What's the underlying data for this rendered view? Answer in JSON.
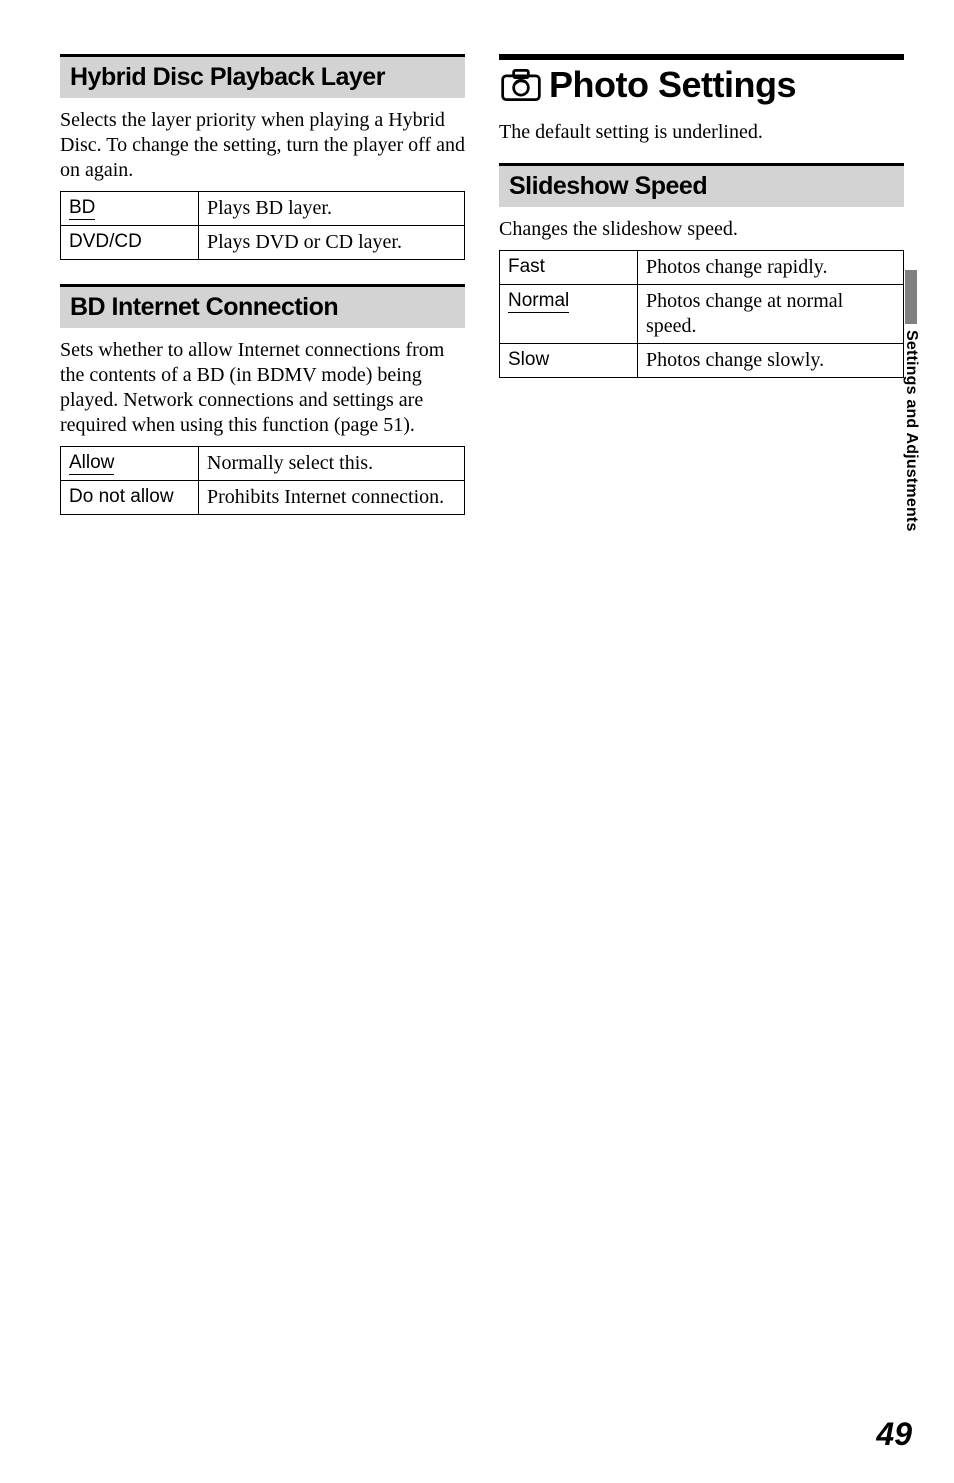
{
  "left": {
    "sec1": {
      "title": "Hybrid Disc Playback Layer",
      "body": "Selects the layer priority when playing a Hybrid Disc. To change the setting, turn the player off and on again.",
      "rows": [
        {
          "key": "BD",
          "underline": true,
          "val": "Plays BD layer."
        },
        {
          "key": "DVD/CD",
          "underline": false,
          "val": "Plays DVD or CD layer."
        }
      ]
    },
    "sec2": {
      "title": "BD Internet Connection",
      "body": "Sets whether to allow Internet connections from the contents of a BD (in BDMV mode) being played. Network connections and settings are required when using this function (page 51).",
      "rows": [
        {
          "key": "Allow",
          "underline": true,
          "val": "Normally select this."
        },
        {
          "key": "Do not allow",
          "underline": false,
          "val": "Prohibits Internet connection."
        }
      ]
    }
  },
  "right": {
    "head": {
      "icon": "photo-camera-icon",
      "title": "Photo Settings"
    },
    "intro": "The default setting is underlined.",
    "sec1": {
      "title": "Slideshow Speed",
      "body": "Changes the slideshow speed.",
      "rows": [
        {
          "key": "Fast",
          "underline": false,
          "val": "Photos change rapidly."
        },
        {
          "key": "Normal",
          "underline": true,
          "val": "Photos change at normal speed."
        },
        {
          "key": "Slow",
          "underline": false,
          "val": "Photos change slowly."
        }
      ]
    }
  },
  "sideTab": "Settings and Adjustments",
  "pageNumber": "49"
}
